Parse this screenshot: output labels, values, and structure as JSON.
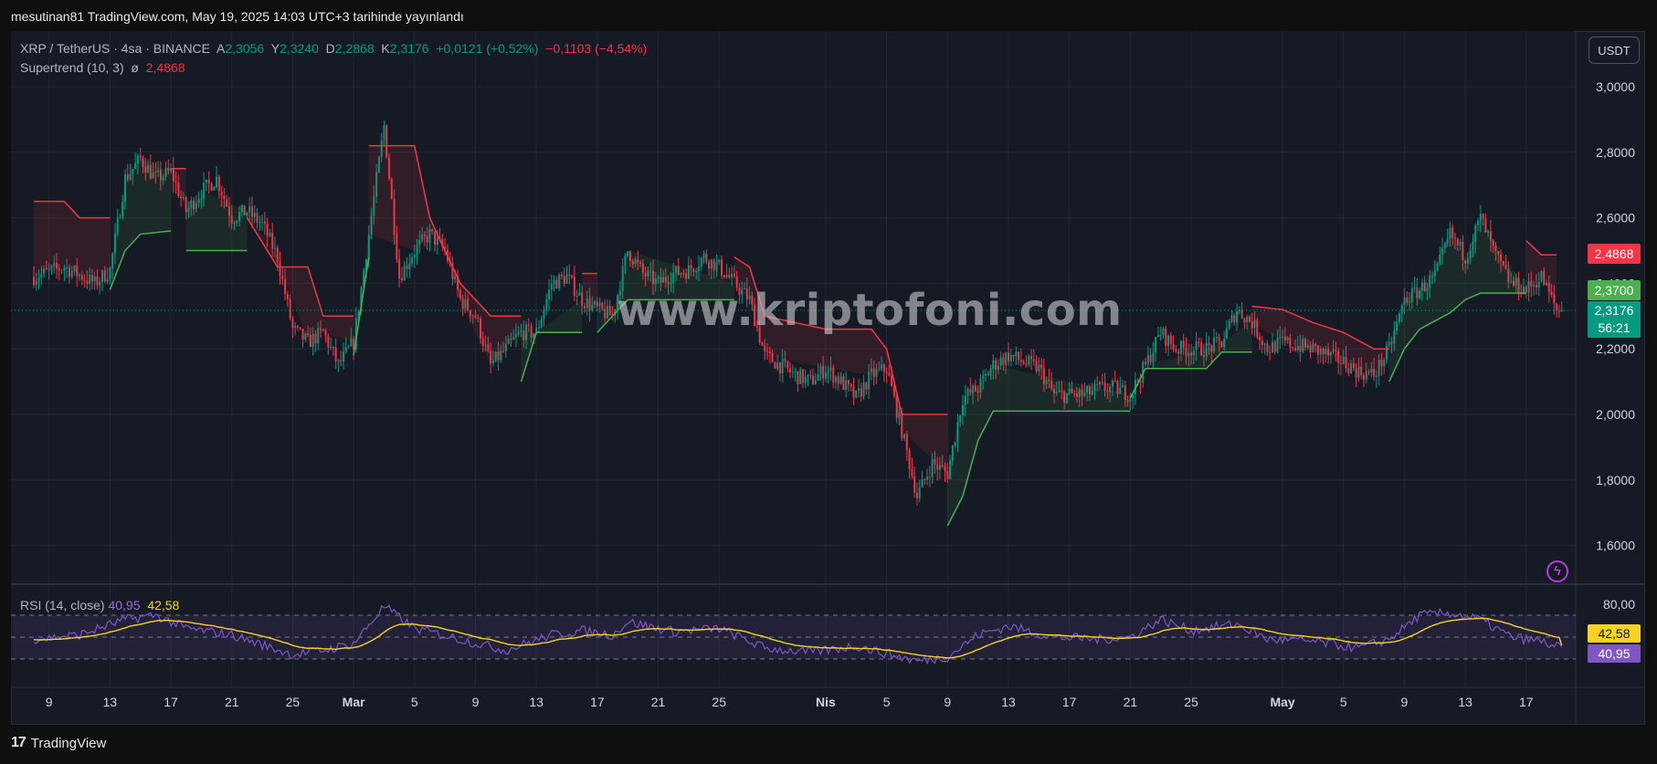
{
  "header": {
    "published": "mesutinan81 TradingView.com, May 19, 2025 14:03 UTC+3 tarihinde yayınlandı"
  },
  "footer": {
    "brand": "TradingView",
    "logo_mark": "17"
  },
  "watermark": "www.kriptofoni.com",
  "currency_button": "USDT",
  "icons": {
    "alert": "lightning-bolt-icon",
    "logo": "tradingview-logo-icon"
  },
  "legend": {
    "symbol": "XRP / TetherUS · 4sa · BINANCE",
    "open_label": "A",
    "open": "2,3056",
    "high_label": "Y",
    "high": "2,3240",
    "low_label": "D",
    "low": "2,2868",
    "close_label": "K",
    "close": "2,3176",
    "change": "+0,0121 (+0,52%)",
    "change2": "−0,1103 (−4,54%)",
    "supertrend_label": "Supertrend (10, 3)",
    "supertrend_symbol": "ø",
    "supertrend_value": "2,4868",
    "rsi_label": "RSI (14, close)",
    "rsi_value": "40,95",
    "rsi_ma_value": "42,58"
  },
  "price_tags": {
    "supertrend_down": "2,4868",
    "supertrend_up": "2,3700",
    "last_price": "2,3176",
    "countdown": "56:21",
    "rsi_ma": "42,58",
    "rsi": "40,95"
  },
  "colors": {
    "background": "#161a25",
    "grid": "#232733",
    "up": "#089981",
    "down": "#f23645",
    "supertrend_up": "#4caf50",
    "supertrend_down": "#f23645",
    "rsi": "#7e57c2",
    "rsi_ma": "#f7d226"
  },
  "chart_data": [
    {
      "type": "candlestick",
      "title": "",
      "symbol": "XRP / TetherUS",
      "interval": "4sa",
      "exchange": "BINANCE",
      "ylim": [
        1.5,
        3.07
      ],
      "y_ticks": [
        "3,0000",
        "2,8000",
        "2,6000",
        "2,4000",
        "2,2000",
        "2,0000",
        "1,8000",
        "1,6000"
      ],
      "x_ticks": [
        "9",
        "13",
        "17",
        "21",
        "25",
        "Mar",
        "5",
        "9",
        "13",
        "17",
        "21",
        "25",
        "Nis",
        "5",
        "9",
        "13",
        "17",
        "21",
        "25",
        "May",
        "5",
        "9",
        "13",
        "17"
      ],
      "grid": true,
      "date_range": [
        "2025-02-08",
        "2025-05-19"
      ],
      "close_path": [
        [
          "2025-02-08",
          2.42
        ],
        [
          "2025-02-10",
          2.45
        ],
        [
          "2025-02-12",
          2.4
        ],
        [
          "2025-02-13",
          2.44
        ],
        [
          "2025-02-14",
          2.72
        ],
        [
          "2025-02-15",
          2.78
        ],
        [
          "2025-02-16",
          2.72
        ],
        [
          "2025-02-17",
          2.74
        ],
        [
          "2025-02-18",
          2.62
        ],
        [
          "2025-02-19",
          2.68
        ],
        [
          "2025-02-20",
          2.72
        ],
        [
          "2025-02-21",
          2.6
        ],
        [
          "2025-02-22",
          2.62
        ],
        [
          "2025-02-23",
          2.58
        ],
        [
          "2025-02-24",
          2.48
        ],
        [
          "2025-02-25",
          2.26
        ],
        [
          "2025-02-26",
          2.22
        ],
        [
          "2025-02-27",
          2.25
        ],
        [
          "2025-02-28",
          2.15
        ],
        [
          "2025-03-01",
          2.22
        ],
        [
          "2025-03-02",
          2.55
        ],
        [
          "2025-03-03",
          2.88
        ],
        [
          "2025-03-04",
          2.42
        ],
        [
          "2025-03-05",
          2.5
        ],
        [
          "2025-03-06",
          2.55
        ],
        [
          "2025-03-07",
          2.5
        ],
        [
          "2025-03-08",
          2.35
        ],
        [
          "2025-03-09",
          2.3
        ],
        [
          "2025-03-10",
          2.15
        ],
        [
          "2025-03-11",
          2.2
        ],
        [
          "2025-03-12",
          2.25
        ],
        [
          "2025-03-13",
          2.25
        ],
        [
          "2025-03-14",
          2.4
        ],
        [
          "2025-03-15",
          2.42
        ],
        [
          "2025-03-16",
          2.35
        ],
        [
          "2025-03-17",
          2.32
        ],
        [
          "2025-03-18",
          2.3
        ],
        [
          "2025-03-19",
          2.5
        ],
        [
          "2025-03-20",
          2.43
        ],
        [
          "2025-03-21",
          2.4
        ],
        [
          "2025-03-22",
          2.43
        ],
        [
          "2025-03-23",
          2.44
        ],
        [
          "2025-03-24",
          2.48
        ],
        [
          "2025-03-25",
          2.45
        ],
        [
          "2025-03-26",
          2.4
        ],
        [
          "2025-03-27",
          2.35
        ],
        [
          "2025-03-28",
          2.18
        ],
        [
          "2025-03-29",
          2.15
        ],
        [
          "2025-03-30",
          2.12
        ],
        [
          "2025-03-31",
          2.1
        ],
        [
          "2025-04-01",
          2.14
        ],
        [
          "2025-04-02",
          2.1
        ],
        [
          "2025-04-03",
          2.05
        ],
        [
          "2025-04-04",
          2.12
        ],
        [
          "2025-04-05",
          2.14
        ],
        [
          "2025-04-06",
          1.95
        ],
        [
          "2025-04-07",
          1.75
        ],
        [
          "2025-04-08",
          1.85
        ],
        [
          "2025-04-09",
          1.82
        ],
        [
          "2025-04-10",
          2.05
        ],
        [
          "2025-04-11",
          2.08
        ],
        [
          "2025-04-12",
          2.15
        ],
        [
          "2025-04-13",
          2.18
        ],
        [
          "2025-04-14",
          2.16
        ],
        [
          "2025-04-15",
          2.14
        ],
        [
          "2025-04-16",
          2.06
        ],
        [
          "2025-04-17",
          2.06
        ],
        [
          "2025-04-18",
          2.06
        ],
        [
          "2025-04-19",
          2.08
        ],
        [
          "2025-04-20",
          2.08
        ],
        [
          "2025-04-21",
          2.06
        ],
        [
          "2025-04-22",
          2.15
        ],
        [
          "2025-04-23",
          2.25
        ],
        [
          "2025-04-24",
          2.2
        ],
        [
          "2025-04-25",
          2.2
        ],
        [
          "2025-04-26",
          2.2
        ],
        [
          "2025-04-27",
          2.22
        ],
        [
          "2025-04-28",
          2.32
        ],
        [
          "2025-04-29",
          2.28
        ],
        [
          "2025-04-30",
          2.2
        ],
        [
          "2025-05-01",
          2.22
        ],
        [
          "2025-05-02",
          2.21
        ],
        [
          "2025-05-03",
          2.2
        ],
        [
          "2025-05-04",
          2.18
        ],
        [
          "2025-05-05",
          2.16
        ],
        [
          "2025-05-06",
          2.13
        ],
        [
          "2025-05-07",
          2.12
        ],
        [
          "2025-05-08",
          2.2
        ],
        [
          "2025-05-09",
          2.35
        ],
        [
          "2025-05-10",
          2.38
        ],
        [
          "2025-05-11",
          2.42
        ],
        [
          "2025-05-12",
          2.55
        ],
        [
          "2025-05-13",
          2.48
        ],
        [
          "2025-05-14",
          2.6
        ],
        [
          "2025-05-15",
          2.48
        ],
        [
          "2025-05-16",
          2.4
        ],
        [
          "2025-05-17",
          2.38
        ],
        [
          "2025-05-18",
          2.42
        ],
        [
          "2025-05-19",
          2.3176
        ]
      ],
      "supertrend": [
        {
          "trend": "down",
          "points": [
            [
              "2025-02-08",
              2.65
            ],
            [
              "2025-02-10",
              2.65
            ],
            [
              "2025-02-11",
              2.6
            ],
            [
              "2025-02-13",
              2.6
            ]
          ]
        },
        {
          "trend": "up",
          "points": [
            [
              "2025-02-13",
              2.38
            ],
            [
              "2025-02-14",
              2.5
            ],
            [
              "2025-02-15",
              2.55
            ],
            [
              "2025-02-17",
              2.56
            ]
          ]
        },
        {
          "trend": "down",
          "points": [
            [
              "2025-02-17",
              2.75
            ],
            [
              "2025-02-18",
              2.75
            ]
          ]
        },
        {
          "trend": "up",
          "points": [
            [
              "2025-02-18",
              2.5
            ],
            [
              "2025-02-19",
              2.5
            ],
            [
              "2025-02-22",
              2.5
            ]
          ]
        },
        {
          "trend": "down",
          "points": [
            [
              "2025-02-22",
              2.6
            ],
            [
              "2025-02-24",
              2.45
            ],
            [
              "2025-02-26",
              2.45
            ],
            [
              "2025-02-27",
              2.3
            ],
            [
              "2025-03-01",
              2.3
            ]
          ]
        },
        {
          "trend": "up",
          "points": [
            [
              "2025-03-01",
              2.18
            ],
            [
              "2025-03-02",
              2.48
            ]
          ]
        },
        {
          "trend": "down",
          "points": [
            [
              "2025-03-02",
              2.82
            ],
            [
              "2025-03-05",
              2.82
            ],
            [
              "2025-03-06",
              2.6
            ],
            [
              "2025-03-07",
              2.5
            ],
            [
              "2025-03-08",
              2.4
            ],
            [
              "2025-03-10",
              2.3
            ],
            [
              "2025-03-12",
              2.3
            ]
          ]
        },
        {
          "trend": "up",
          "points": [
            [
              "2025-03-12",
              2.1
            ],
            [
              "2025-03-13",
              2.25
            ],
            [
              "2025-03-16",
              2.25
            ]
          ]
        },
        {
          "trend": "down",
          "points": [
            [
              "2025-03-16",
              2.43
            ],
            [
              "2025-03-17",
              2.43
            ]
          ]
        },
        {
          "trend": "up",
          "points": [
            [
              "2025-03-17",
              2.25
            ],
            [
              "2025-03-18",
              2.3
            ],
            [
              "2025-03-19",
              2.35
            ],
            [
              "2025-03-26",
              2.35
            ]
          ]
        },
        {
          "trend": "down",
          "points": [
            [
              "2025-03-26",
              2.48
            ],
            [
              "2025-03-27",
              2.45
            ],
            [
              "2025-03-28",
              2.3
            ],
            [
              "2025-04-01",
              2.26
            ],
            [
              "2025-04-04",
              2.26
            ],
            [
              "2025-04-05",
              2.2
            ],
            [
              "2025-04-06",
              2.0
            ],
            [
              "2025-04-09",
              2.0
            ]
          ]
        },
        {
          "trend": "up",
          "points": [
            [
              "2025-04-09",
              1.66
            ],
            [
              "2025-04-10",
              1.75
            ],
            [
              "2025-04-11",
              1.92
            ],
            [
              "2025-04-12",
              2.01
            ],
            [
              "2025-04-21",
              2.01
            ]
          ]
        },
        {
          "trend": "up",
          "points": [
            [
              "2025-04-21",
              2.05
            ],
            [
              "2025-04-22",
              2.14
            ],
            [
              "2025-04-26",
              2.14
            ],
            [
              "2025-04-27",
              2.19
            ],
            [
              "2025-04-29",
              2.19
            ]
          ]
        },
        {
          "trend": "down",
          "points": [
            [
              "2025-04-29",
              2.33
            ],
            [
              "2025-05-01",
              2.32
            ],
            [
              "2025-05-03",
              2.28
            ],
            [
              "2025-05-05",
              2.25
            ],
            [
              "2025-05-07",
              2.2
            ],
            [
              "2025-05-08",
              2.2
            ]
          ]
        },
        {
          "trend": "up",
          "points": [
            [
              "2025-05-08",
              2.1
            ],
            [
              "2025-05-09",
              2.2
            ],
            [
              "2025-05-10",
              2.26
            ],
            [
              "2025-05-12",
              2.31
            ],
            [
              "2025-05-13",
              2.35
            ],
            [
              "2025-05-14",
              2.37
            ],
            [
              "2025-05-17",
              2.37
            ]
          ]
        },
        {
          "trend": "down",
          "points": [
            [
              "2025-05-17",
              2.53
            ],
            [
              "2025-05-18",
              2.4868
            ],
            [
              "2025-05-19",
              2.4868
            ]
          ]
        }
      ],
      "last_price": 2.3176
    },
    {
      "type": "line",
      "title": "RSI (14, close)",
      "ylim": [
        17,
        90
      ],
      "y_ticks": [
        "80,00"
      ],
      "bands": [
        70,
        50,
        30
      ],
      "series": [
        {
          "name": "RSI",
          "color": "#7e57c2",
          "last": 40.95
        },
        {
          "name": "RSI-based MA",
          "color": "#f7d226",
          "last": 42.58
        }
      ],
      "rsi_path": [
        [
          "2025-02-08",
          48
        ],
        [
          "2025-02-11",
          52
        ],
        [
          "2025-02-14",
          66
        ],
        [
          "2025-02-16",
          70
        ],
        [
          "2025-02-18",
          58
        ],
        [
          "2025-02-21",
          52
        ],
        [
          "2025-02-25",
          34
        ],
        [
          "2025-02-27",
          38
        ],
        [
          "2025-03-01",
          44
        ],
        [
          "2025-03-03",
          78
        ],
        [
          "2025-03-05",
          58
        ],
        [
          "2025-03-08",
          48
        ],
        [
          "2025-03-11",
          38
        ],
        [
          "2025-03-14",
          52
        ],
        [
          "2025-03-16",
          56
        ],
        [
          "2025-03-18",
          52
        ],
        [
          "2025-03-19",
          64
        ],
        [
          "2025-03-22",
          55
        ],
        [
          "2025-03-25",
          58
        ],
        [
          "2025-03-28",
          40
        ],
        [
          "2025-03-31",
          36
        ],
        [
          "2025-04-03",
          42
        ],
        [
          "2025-04-07",
          28
        ],
        [
          "2025-04-09",
          32
        ],
        [
          "2025-04-11",
          52
        ],
        [
          "2025-04-13",
          60
        ],
        [
          "2025-04-16",
          50
        ],
        [
          "2025-04-19",
          48
        ],
        [
          "2025-04-21",
          50
        ],
        [
          "2025-04-23",
          66
        ],
        [
          "2025-04-25",
          56
        ],
        [
          "2025-04-28",
          62
        ],
        [
          "2025-04-30",
          48
        ],
        [
          "2025-05-03",
          46
        ],
        [
          "2025-05-06",
          40
        ],
        [
          "2025-05-08",
          48
        ],
        [
          "2025-05-10",
          70
        ],
        [
          "2025-05-12",
          72
        ],
        [
          "2025-05-14",
          66
        ],
        [
          "2025-05-16",
          50
        ],
        [
          "2025-05-18",
          46
        ],
        [
          "2025-05-19",
          40.95
        ]
      ]
    }
  ]
}
